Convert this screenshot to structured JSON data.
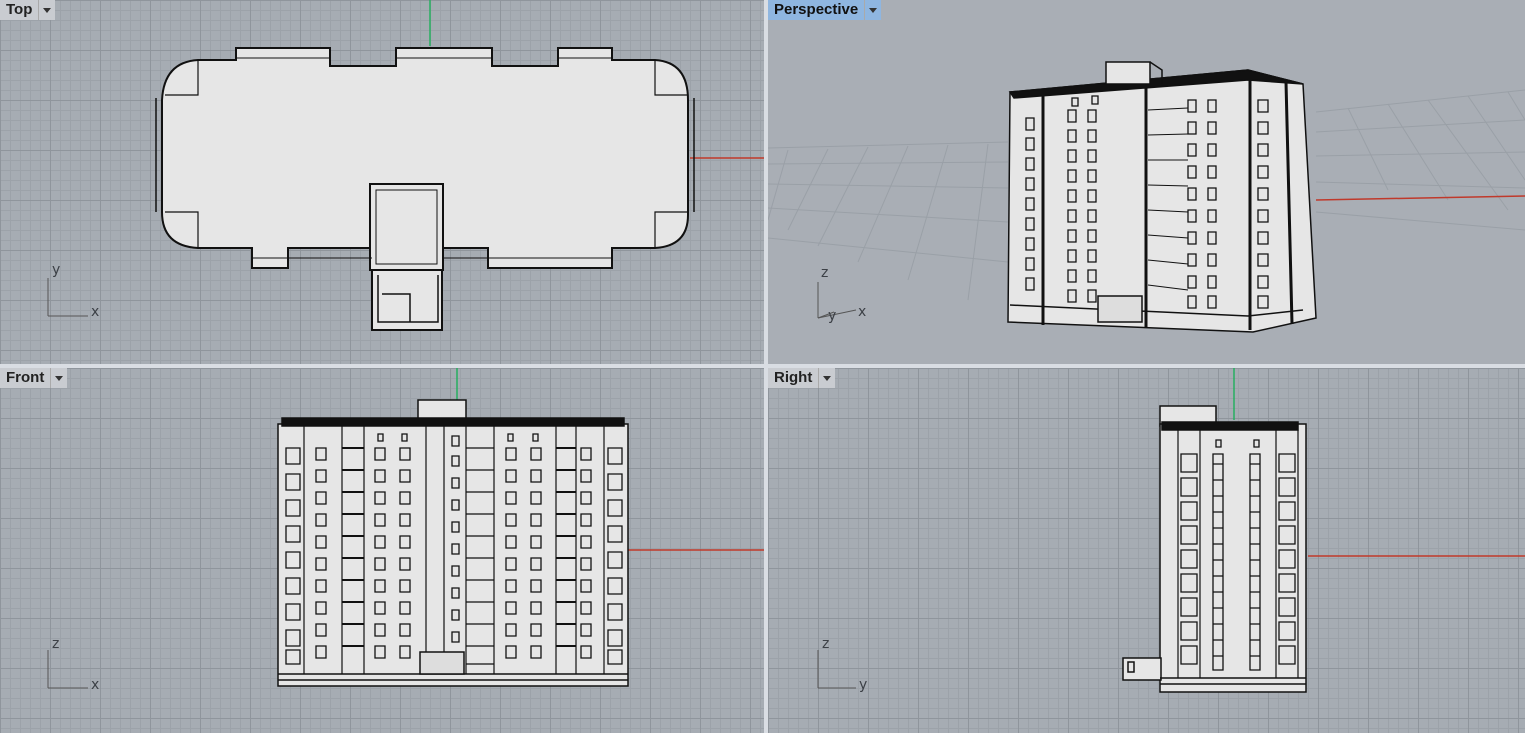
{
  "viewports": {
    "top": {
      "title": "Top",
      "axes": {
        "vertical": "y",
        "horizontal": "x"
      }
    },
    "perspective": {
      "title": "Perspective",
      "axes": {
        "vertical": "z",
        "diag": "y",
        "horizontal": "x"
      }
    },
    "front": {
      "title": "Front",
      "axes": {
        "vertical": "z",
        "horizontal": "x"
      }
    },
    "right": {
      "title": "Right",
      "axes": {
        "vertical": "z",
        "horizontal": "y"
      }
    }
  },
  "colors": {
    "x_axis": "#c0392b",
    "y_axis": "#27ae60",
    "active_title": "#8fb6e0",
    "model_fill": "#e6e6e6"
  }
}
